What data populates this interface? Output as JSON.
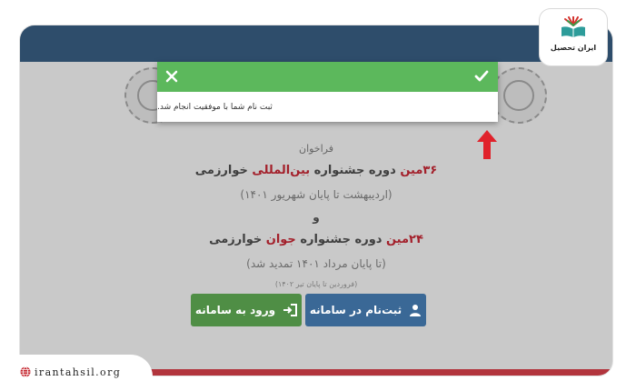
{
  "modal": {
    "message": "ثبت نام شما با موفقیت انجام شد."
  },
  "announcement": {
    "call": "فراخوان",
    "festival1": {
      "ordinal": "۳۶مین",
      "text_a": " دوره جشنواره ",
      "highlight": "بین‌المللی",
      "text_b": " خوارزمی"
    },
    "festival1_period": "(اردیبهشت تا پایان شهریور ۱۴۰۱)",
    "and": "و",
    "festival2": {
      "ordinal": "۲۴مین",
      "text_a": " دوره جشنواره ",
      "highlight": "جوان",
      "text_b": " خوارزمی"
    },
    "festival2_period": "(تا پایان مرداد ۱۴۰۱ تمدید شد)",
    "note": "(فروردین تا پایان تیر ۱۴۰۲)"
  },
  "buttons": {
    "register": "ثبت‌نام در سامانه",
    "login": "ورود به سامانه"
  },
  "logo": {
    "name": "ایران تحصیل"
  },
  "site_url": "irantahsil.org",
  "colors": {
    "header": "#2e4d6b",
    "success": "#5cb85c",
    "register_button": "#3a6896",
    "login_button": "#4f8e45",
    "accent_red": "#e0222b"
  }
}
